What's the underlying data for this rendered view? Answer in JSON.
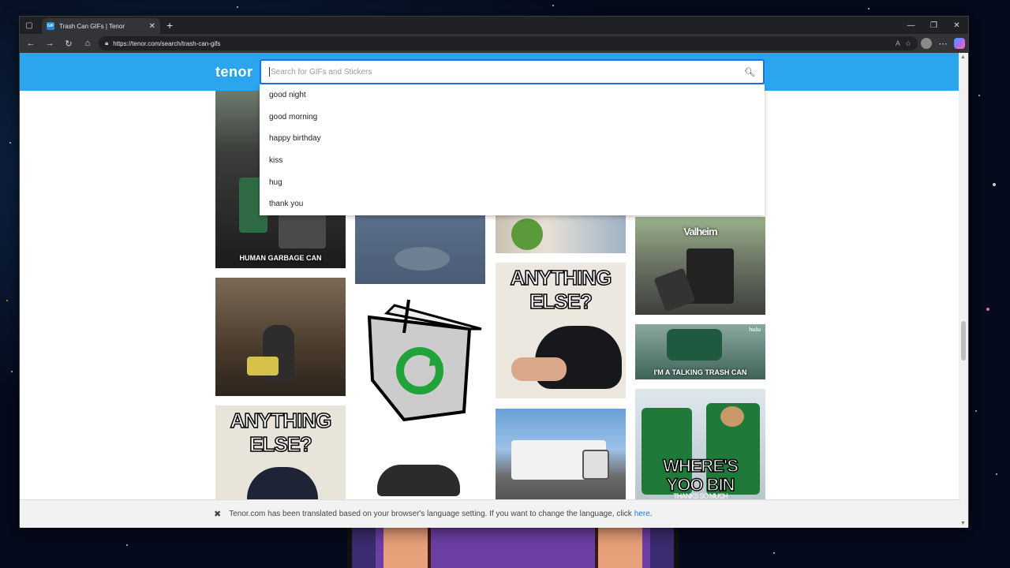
{
  "browser": {
    "tab_title": "Trash Can GIFs | Tenor",
    "favicon_label": "GIF",
    "url": "https://tenor.com/search/trash-can-gifs"
  },
  "site": {
    "logo": "tenor",
    "search_placeholder": "Search for GIFs and Stickers",
    "suggestions": [
      "good night",
      "good morning",
      "happy birthday",
      "kiss",
      "hug",
      "thank you"
    ]
  },
  "gifs": {
    "caption_1": "HUMAN GARBAGE CAN",
    "caption_2": "Valheim",
    "caption_3": "I'M A TALKING TRASH CAN",
    "label_hulu": "hulu",
    "anything_else_line1": "ANYTHING",
    "anything_else_line2": "ELSE?",
    "anything_else_b_line1": "ANYTHING",
    "anything_else_b_line2": "ELSE?",
    "yoo_bin_line1": "WHERE'S",
    "yoo_bin_line2": "YOO BIN",
    "yoo_bin_sub": "THANKS SO MUCH"
  },
  "banner": {
    "message": "Tenor.com has been translated based on your browser's language setting. If you want to change the language, click",
    "link": "here",
    "trailing": "."
  }
}
